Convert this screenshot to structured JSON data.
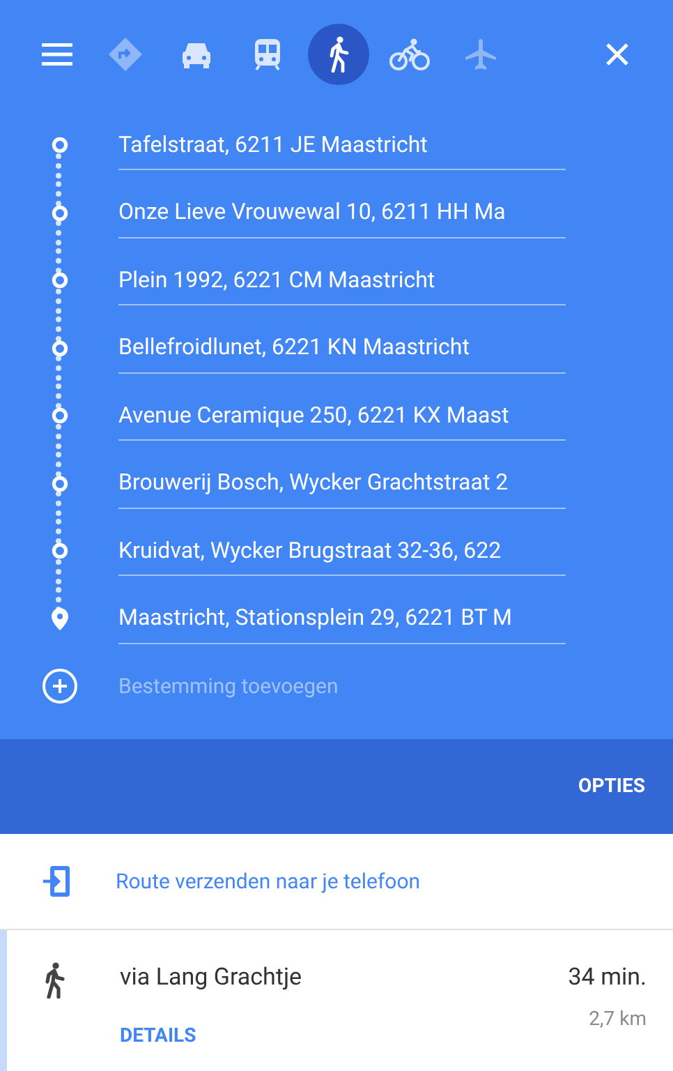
{
  "modes": [
    {
      "kind": "best",
      "selected": false,
      "disabled": true
    },
    {
      "kind": "car",
      "selected": false,
      "disabled": false
    },
    {
      "kind": "transit",
      "selected": false,
      "disabled": false
    },
    {
      "kind": "walk",
      "selected": true,
      "disabled": false
    },
    {
      "kind": "bike",
      "selected": false,
      "disabled": false
    },
    {
      "kind": "flight",
      "selected": false,
      "disabled": true
    }
  ],
  "stops": [
    {
      "kind": "waypoint",
      "value": "Tafelstraat, 6211 JE Maastricht"
    },
    {
      "kind": "waypoint",
      "value": "Onze Lieve Vrouwewal 10, 6211 HH Ma"
    },
    {
      "kind": "waypoint",
      "value": "Plein 1992, 6221 CM Maastricht"
    },
    {
      "kind": "waypoint",
      "value": "Bellefroidlunet, 6221 KN Maastricht"
    },
    {
      "kind": "waypoint",
      "value": "Avenue Ceramique 250, 6221 KX Maast"
    },
    {
      "kind": "waypoint",
      "value": "Brouwerij Bosch, Wycker Grachtstraat 2"
    },
    {
      "kind": "waypoint",
      "value": "Kruidvat, Wycker Brugstraat 32-36, 622"
    },
    {
      "kind": "destination",
      "value": "Maastricht, Stationsplein 29, 6221 BT M"
    }
  ],
  "add_destination": {
    "placeholder": "Bestemming toevoegen"
  },
  "options_button": "OPTIES",
  "send_to_phone": "Route verzenden naar je telefoon",
  "route": {
    "name": "via Lang Grachtje",
    "duration": "34 min.",
    "distance": "2,7 km",
    "details_link": "DETAILS"
  }
}
